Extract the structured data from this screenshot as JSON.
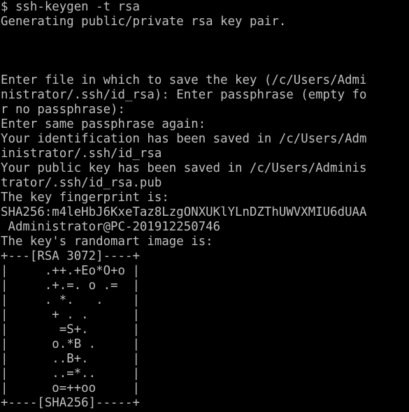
{
  "terminal": {
    "lines": [
      "$ ssh-keygen -t rsa",
      "Generating public/private rsa key pair.",
      "",
      "",
      "",
      "Enter file in which to save the key (/c/Users/Admi",
      "nistrator/.ssh/id_rsa): Enter passphrase (empty fo",
      "r no passphrase):",
      "Enter same passphrase again:",
      "Your identification has been saved in /c/Users/Adm",
      "inistrator/.ssh/id_rsa",
      "Your public key has been saved in /c/Users/Adminis",
      "trator/.ssh/id_rsa.pub",
      "The key fingerprint is:",
      "SHA256:m4leHbJ6KxeTaz8LzgONXUKlYLnDZThUWVXMIU6dUAA",
      " Administrator@PC-201912250746",
      "The key's randomart image is:",
      "+---[RSA 3072]----+",
      "|     .++.+Eo*O+o |",
      "|     .+.=. o .=  |",
      "|     . *.   .    |",
      "|      + . .      |",
      "|       =S+.      |",
      "|      o.*B .     |",
      "|      ..B+.      |",
      "|      ..=*..     |",
      "|      o=++oo     |",
      "+----[SHA256]-----+"
    ]
  }
}
